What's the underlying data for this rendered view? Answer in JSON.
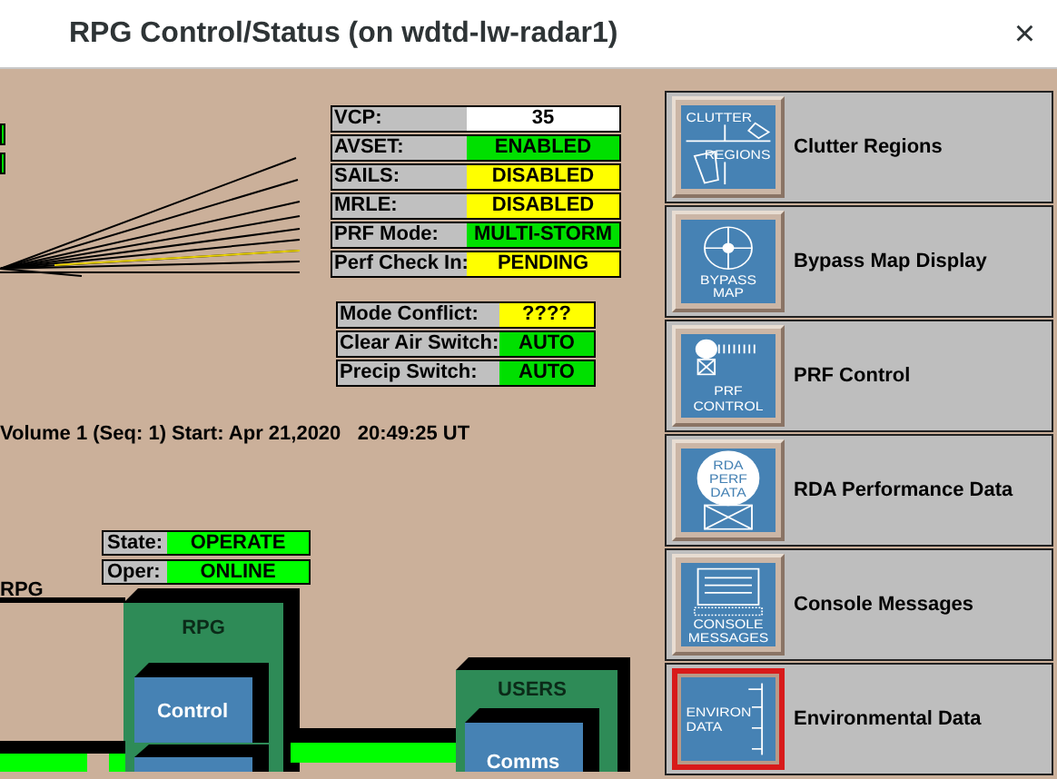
{
  "window": {
    "title": "RPG Control/Status (on wdtd-lw-radar1)",
    "close": "×"
  },
  "status": [
    {
      "label": "VCP:",
      "value": "35",
      "color": "#ffffff"
    },
    {
      "label": "AVSET:",
      "value": "ENABLED",
      "color": "#00e000"
    },
    {
      "label": "SAILS:",
      "value": "DISABLED",
      "color": "#ffff00"
    },
    {
      "label": "MRLE:",
      "value": "DISABLED",
      "color": "#ffff00"
    },
    {
      "label": "PRF Mode:",
      "value": "MULTI-STORM",
      "color": "#00e000"
    },
    {
      "label": "Perf Check In:",
      "value": "PENDING",
      "color": "#ffff00"
    }
  ],
  "switches": [
    {
      "label": "Mode Conflict:",
      "value": "????",
      "color": "#ffff00"
    },
    {
      "label": "Clear Air Switch:",
      "value": "AUTO",
      "color": "#00e000"
    },
    {
      "label": "Precip Switch:",
      "value": "AUTO",
      "color": "#00e000"
    }
  ],
  "volume": "Volume 1 (Seq: 1) Start: Apr 21,2020   20:49:25 UT",
  "rpg_state": [
    {
      "label": "State:",
      "value": "OPERATE",
      "color": "#00ff00"
    },
    {
      "label": "Oper:",
      "value": "ONLINE",
      "color": "#00ff00"
    }
  ],
  "diagram": {
    "rpg_label": "RPG",
    "rpg_box": "RPG",
    "control": "Control",
    "users": "USERS",
    "comms": "Comms"
  },
  "tools": [
    {
      "kind": "clutter",
      "caption": [
        "CLUTTER",
        "REGIONS"
      ],
      "label": "Clutter Regions",
      "selected": false
    },
    {
      "kind": "bypass",
      "caption": [
        "BYPASS",
        "MAP"
      ],
      "label": "Bypass Map Display",
      "selected": false
    },
    {
      "kind": "prf",
      "caption": [
        "PRF",
        "CONTROL"
      ],
      "label": "PRF Control",
      "selected": false
    },
    {
      "kind": "rda",
      "caption": [
        "RDA",
        "PERF",
        "DATA"
      ],
      "label": "RDA Performance Data",
      "selected": false
    },
    {
      "kind": "console",
      "caption": [
        "CONSOLE",
        "MESSAGES"
      ],
      "label": "Console Messages",
      "selected": false
    },
    {
      "kind": "environ",
      "caption": [
        "ENVIRON",
        "DATA"
      ],
      "label": "Environmental Data",
      "selected": true
    }
  ]
}
